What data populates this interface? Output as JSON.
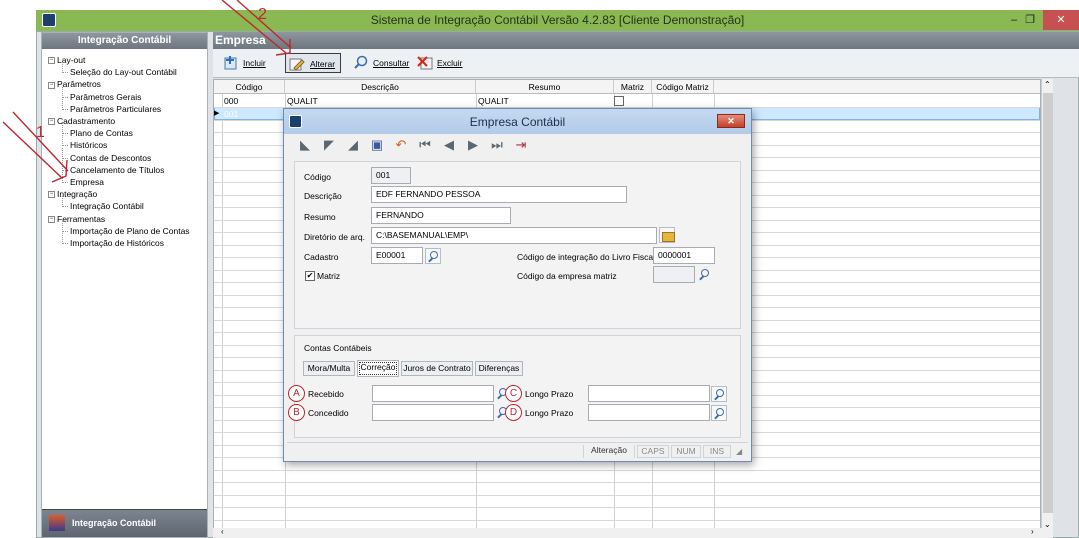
{
  "window": {
    "title": "Sistema de Integração Contábil Versão 4.2.83 [Cliente Demonstração]",
    "minimize": "–",
    "restore": "❐",
    "close": "✕"
  },
  "sidebar": {
    "header": "Integração Contábil",
    "tree": [
      {
        "label": "Lay-out",
        "children": [
          "Seleção do Lay-out Contábil"
        ]
      },
      {
        "label": "Parâmetros",
        "children": [
          "Parâmetros Gerais",
          "Parâmetros Particulares"
        ]
      },
      {
        "label": "Cadastramento",
        "children": [
          "Plano de Contas",
          "Históricos",
          "Contas de Descontos",
          "Cancelamento de Títulos",
          "Empresa"
        ]
      },
      {
        "label": "Integração",
        "children": [
          "Integração Contábil"
        ]
      },
      {
        "label": "Ferramentas",
        "children": [
          "Importação de Plano de Contas",
          "Importação de Históricos"
        ]
      }
    ],
    "footer": "Integração Contábil"
  },
  "main": {
    "header": "Empresa",
    "toolbar": {
      "incluir": "Incluir",
      "alterar": "Alterar",
      "consultar": "Consultar",
      "excluir": "Excluir"
    },
    "grid": {
      "columns": [
        "Código",
        "Descrição",
        "Resumo",
        "Matriz",
        "Código Matriz"
      ],
      "rows": [
        {
          "codigo": "000",
          "descricao": "QUALIT",
          "resumo": "QUALIT",
          "matriz": "",
          "codigo_matriz": ""
        },
        {
          "codigo": "001",
          "descricao": "",
          "resumo": "",
          "matriz": "",
          "codigo_matriz": ""
        }
      ]
    }
  },
  "dialog": {
    "title": "Empresa Contábil",
    "close": "✕",
    "fields": {
      "codigo_label": "Código",
      "codigo_value": "001",
      "descricao_label": "Descrição",
      "descricao_value": "EDF FERNANDO PESSOA",
      "resumo_label": "Resumo",
      "resumo_value": "FERNANDO",
      "diretorio_label": "Diretório de arq.",
      "diretorio_value": "C:\\BASEMANUAL\\EMP\\",
      "cadastro_label": "Cadastro",
      "cadastro_value": "E00001",
      "cod_integracao_label": "Código de integração do Livro Fiscal",
      "cod_integracao_value": "0000001",
      "matriz_label": "Matriz",
      "matriz_checked": "✔",
      "cod_empresa_matriz_label": "Código da empresa matriz",
      "cod_empresa_matriz_value": ""
    },
    "contas": {
      "title": "Contas Contábeis",
      "tabs": [
        "Mora/Multa",
        "Correção",
        "Juros de Contrato",
        "Diferenças"
      ],
      "recebido_label": "Recebido",
      "concedido_label": "Concedido",
      "longo_prazo_c_label": "Longo Prazo",
      "longo_prazo_d_label": "Longo Prazo"
    },
    "status": {
      "mode": "Alteração",
      "caps": "CAPS",
      "num": "NUM",
      "ins": "INS"
    }
  },
  "annotations": {
    "marker1": "1",
    "marker2": "2",
    "A": "A",
    "B": "B",
    "C": "C",
    "D": "D"
  }
}
